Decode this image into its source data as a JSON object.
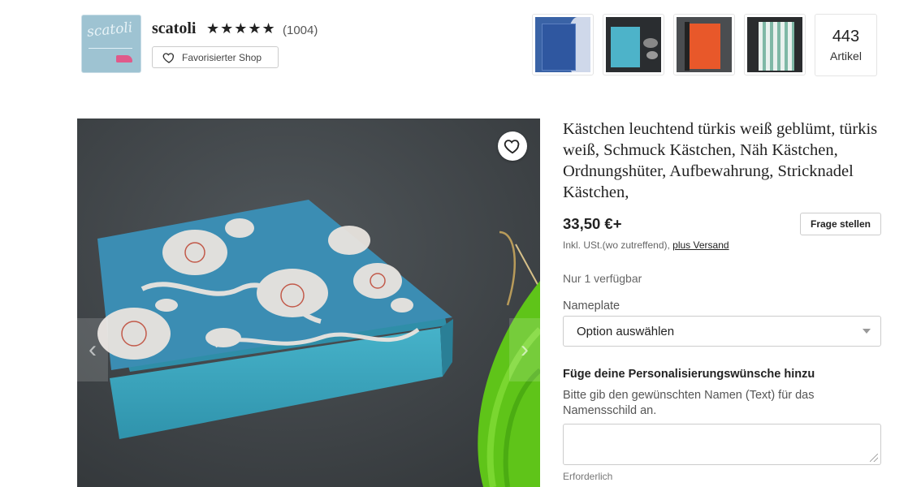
{
  "shop": {
    "logo_text": "scatoli",
    "name": "scatoli",
    "stars": "★★★★★",
    "review_count": "(1004)",
    "favorite_label": "Favorisierter Shop",
    "item_count": "443",
    "item_count_label": "Artikel"
  },
  "listing": {
    "title": "Kästchen leuchtend türkis weiß geblümt, türkis weiß, Schmuck Kästchen, Näh Kästchen, Ordnungshüter, Aufbewahrung, Stricknadel Kästchen,",
    "price": "33,50 €+",
    "ask_label": "Frage stellen",
    "tax_note": "Inkl. USt.(wo zutreffend), ",
    "shipping_link": "plus Versand",
    "availability": "Nur 1 verfügbar",
    "nameplate_label": "Nameplate",
    "select_value": "Option auswählen",
    "personalization_heading": "Füge deine Personalisierungswünsche hinzu",
    "personalization_desc": "Bitte gib den gewünschten Namen (Text) für das Namensschild an.",
    "personalization_value": "",
    "required_label": "Erforderlich"
  },
  "icons": {
    "heart": "heart-outline-icon",
    "prev": "chevron-left-icon",
    "next": "chevron-right-icon",
    "caret": "caret-down-icon"
  },
  "colors": {
    "box_teal": "#3a8fb0",
    "box_side": "#3fa6bf",
    "background_dark": "#3d4144",
    "yarn_green": "#5fc419"
  }
}
